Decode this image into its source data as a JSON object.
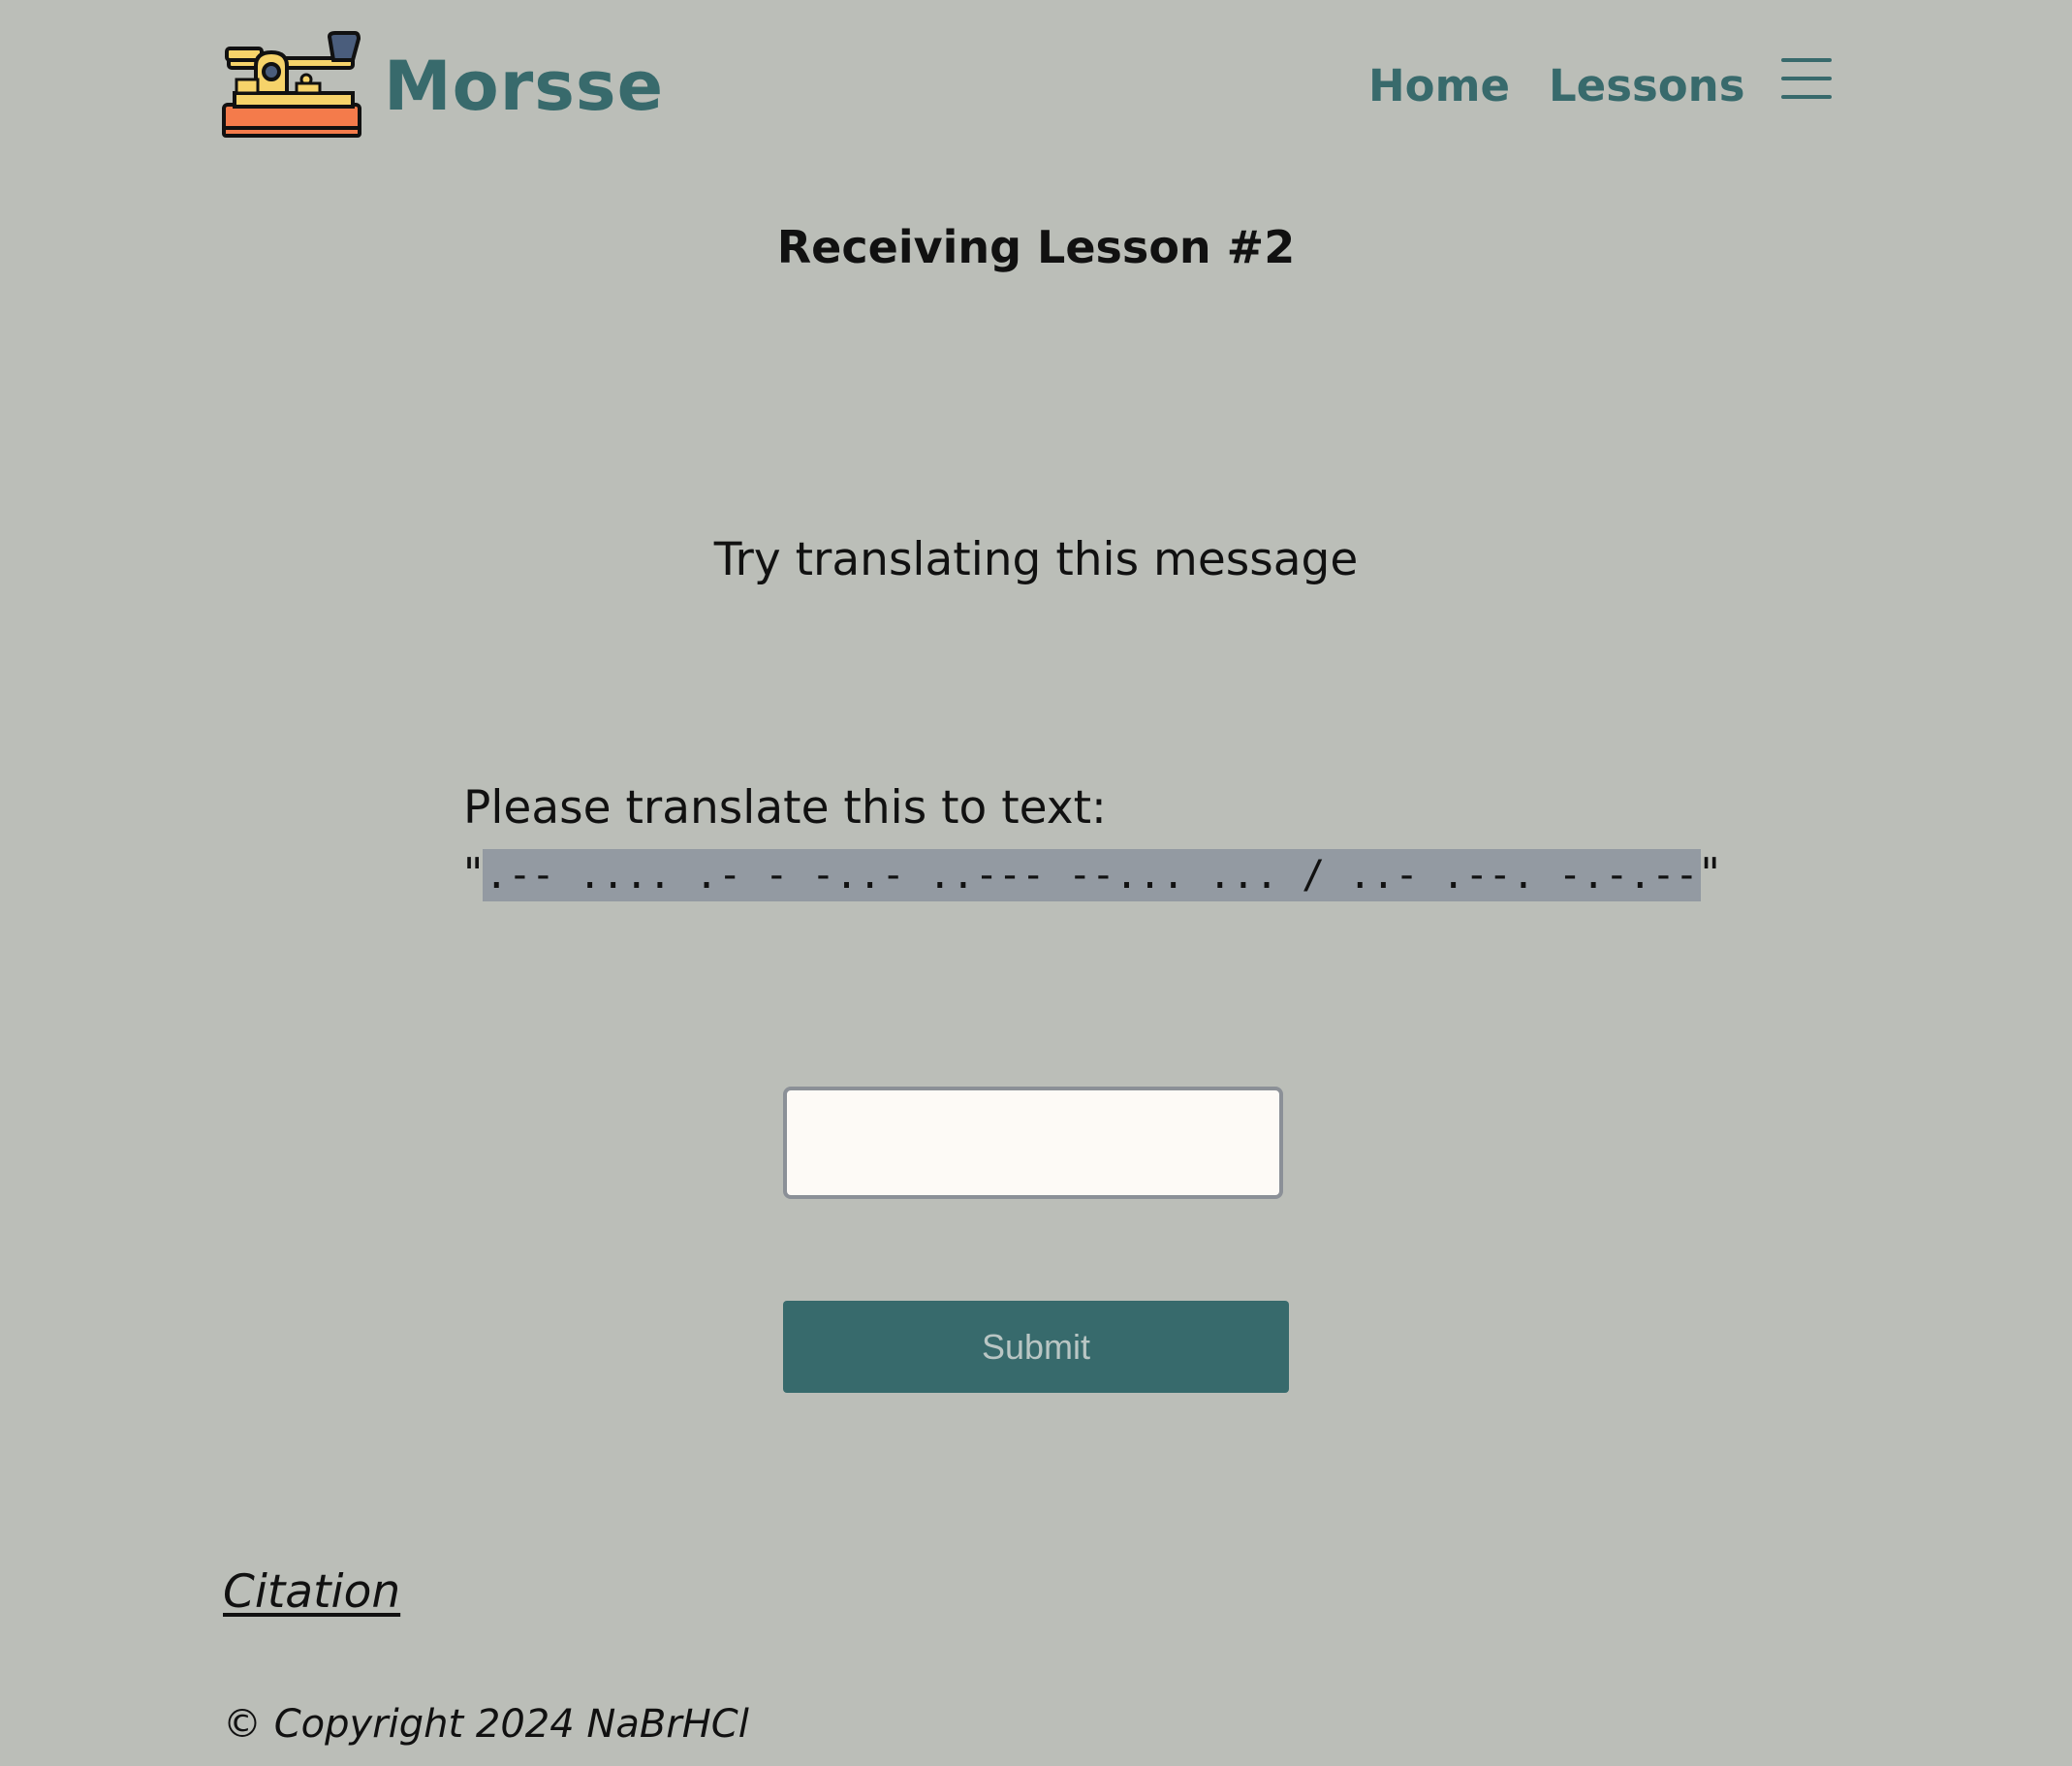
{
  "brand": {
    "name": "Morsse",
    "logo_icon": "telegraph-key-icon"
  },
  "nav": {
    "home_label": "Home",
    "lessons_label": "Lessons",
    "menu_icon": "hamburger-menu-icon"
  },
  "lesson": {
    "title": "Receiving Lesson #2",
    "prompt": "Try translating this message",
    "instruction": "Please translate this to text:",
    "quote_open": "\"",
    "morse": ".-- .... .- - -..- ..--- --... ... / ..- .--. -.-.--",
    "quote_close": "\""
  },
  "form": {
    "answer_value": "",
    "submit_label": "Submit"
  },
  "footer": {
    "citation_label": "Citation",
    "copyright": "© Copyright 2024 NaBrHCl"
  },
  "colors": {
    "background": "#bbbeb8",
    "accent": "#386a6c",
    "highlight": "#939aa2",
    "input_bg": "#fdfaf6",
    "logo_orange": "#f47b4b",
    "logo_yellow": "#f6d36a",
    "logo_blue": "#4a5d7c"
  }
}
